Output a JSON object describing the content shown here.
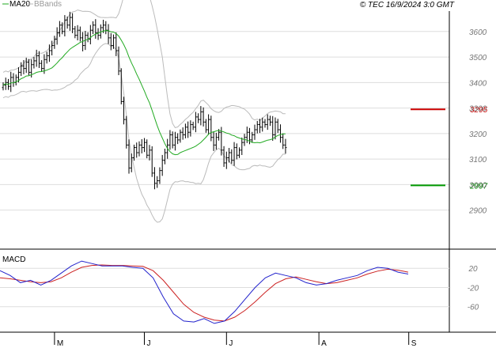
{
  "header": {
    "legend_ma": "MA20",
    "legend_bbands": "BBands",
    "copyright": "© TEC 16/9/2024 3:0 GMT"
  },
  "colors": {
    "candle": "#000000",
    "ma": "#22aa22",
    "bbands": "#bbbbbb",
    "grid": "#dddddd",
    "resistance": "#cc0000",
    "support": "#009900",
    "macd": "#2222cc",
    "signal": "#cc2222"
  },
  "chart_data": [
    {
      "type": "candlestick",
      "name": "price",
      "ylim": [
        2750,
        3680
      ],
      "yticks": [
        2900,
        3000,
        3100,
        3200,
        3300,
        3400,
        3500,
        3600
      ],
      "ytick_labels": [
        "2900",
        "3000",
        "3100",
        "3200",
        "3300",
        "3400",
        "3500",
        "3600"
      ],
      "x_month_labels": [
        {
          "label": "M",
          "index": 20
        },
        {
          "label": "J",
          "index": 55
        },
        {
          "label": "J",
          "index": 87
        },
        {
          "label": "A",
          "index": 123
        },
        {
          "label": "S",
          "index": 158
        }
      ],
      "close": [
        3390,
        3400,
        3385,
        3420,
        3400,
        3420,
        3440,
        3465,
        3455,
        3480,
        3440,
        3470,
        3485,
        3505,
        3475,
        3455,
        3490,
        3505,
        3525,
        3545,
        3570,
        3595,
        3625,
        3600,
        3645,
        3625,
        3655,
        3610,
        3585,
        3605,
        3575,
        3545,
        3585,
        3570,
        3605,
        3625,
        3595,
        3585,
        3615,
        3625,
        3605,
        3575,
        3545,
        3575,
        3525,
        3445,
        3325,
        3255,
        3155,
        3065,
        3105,
        3145,
        3125,
        3155,
        3145,
        3165,
        3115,
        3135,
        3045,
        3005,
        3015,
        3055,
        3095,
        3125,
        3155,
        3195,
        3155,
        3185,
        3175,
        3205,
        3195,
        3225,
        3205,
        3235,
        3225,
        3265,
        3255,
        3285,
        3245,
        3215,
        3255,
        3185,
        3155,
        3185,
        3205,
        3135,
        3085,
        3105,
        3125,
        3095,
        3145,
        3115,
        3135,
        3165,
        3185,
        3205,
        3175,
        3195,
        3215,
        3235,
        3225,
        3245,
        3235,
        3255,
        3245,
        3195,
        3245,
        3215,
        3185,
        3155,
        3145
      ],
      "annotations": [
        {
          "label": "3295",
          "value": 3295,
          "kind": "resistance"
        },
        {
          "label": "2997",
          "value": 2997,
          "kind": "support"
        }
      ]
    },
    {
      "type": "line",
      "name": "MACD",
      "title": "MACD",
      "ylim": [
        -110,
        55
      ],
      "yticks": [
        20,
        -20,
        -60
      ],
      "ytick_labels": [
        "20",
        "-20",
        "-60"
      ],
      "series": [
        {
          "name": "MACD",
          "values": [
            15,
            5,
            -10,
            -5,
            -15,
            -5,
            10,
            25,
            35,
            30,
            25,
            25,
            25,
            22,
            20,
            0,
            -40,
            -75,
            -90,
            -92,
            -85,
            -95,
            -90,
            -70,
            -45,
            -20,
            0,
            10,
            5,
            0,
            -10,
            -15,
            -12,
            -5,
            0,
            5,
            15,
            22,
            20,
            12,
            8
          ]
        },
        {
          "name": "Signal",
          "values": [
            0,
            -2,
            -5,
            -8,
            -10,
            -8,
            0,
            12,
            22,
            26,
            27,
            26,
            26,
            25,
            24,
            15,
            -5,
            -30,
            -55,
            -72,
            -82,
            -88,
            -90,
            -82,
            -68,
            -50,
            -30,
            -12,
            -2,
            2,
            -3,
            -8,
            -12,
            -10,
            -5,
            0,
            8,
            14,
            18,
            16,
            12
          ]
        }
      ]
    }
  ]
}
